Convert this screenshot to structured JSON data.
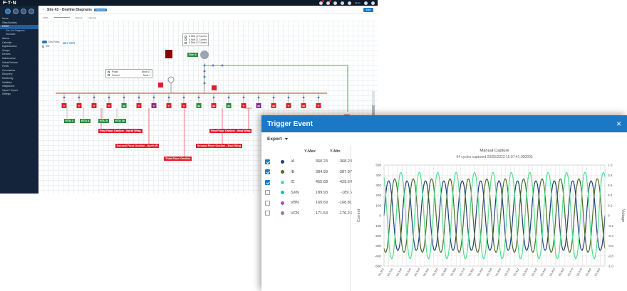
{
  "topbar": {
    "logo": "F∙T∙N",
    "user": "admin",
    "notification_badges": [
      "1",
      "1",
      "2",
      "1"
    ]
  },
  "sidebar": {
    "items": [
      {
        "label": "Home"
      },
      {
        "label": "Sites/Subsites"
      },
      {
        "label": "DTMO",
        "active": true
      },
      {
        "label": "Site List Diagrams",
        "sub": true
      },
      {
        "label": "Standard",
        "sub": true
      },
      {
        "label": "Alarms"
      },
      {
        "label": "Calendar"
      },
      {
        "label": "Digital Access"
      },
      {
        "label": "Groups"
      },
      {
        "label": "Devices"
      },
      {
        "label": "Maintenance"
      },
      {
        "label": "Virtual Devices"
      },
      {
        "label": "Points"
      },
      {
        "label": "Connections"
      },
      {
        "label": "Discovery"
      },
      {
        "label": "Monitoring"
      },
      {
        "label": "Variables"
      },
      {
        "label": "Integrations"
      },
      {
        "label": "Import / Export"
      },
      {
        "label": "Settings"
      }
    ]
  },
  "header": {
    "back": "‹",
    "title": "Site 43 - Oneline Diagrams",
    "badge": "PREVIEW",
    "edit": "Edit"
  },
  "toolbar": {
    "zoom": "100%",
    "mode": "Shared",
    "type": "Lifecycle"
  },
  "canvas": {
    "toggle1": "Only Rows",
    "toggle2": "Site",
    "inline": "SELF TEST",
    "box_top": [
      "A Side | 2 Current",
      "A Side | 1 Current",
      "A Side | 2 Current"
    ],
    "box_left": {
      "r1": "Phase",
      "r1v": "Block 01",
      "r2": "Current",
      "r2v": "Node 1"
    },
    "gen": "Gen 3",
    "rtus": [
      "RTU 1",
      "RTU 3",
      "RTU 5",
      "RTU 10"
    ],
    "floors": [
      "First Floor Oneline - North Wing",
      "Second Floor Oneline - North W",
      "Third Floor Oneline",
      "Second Floor Oneline - East Wing",
      "First Floor Oneline - East Wing"
    ],
    "breakers": [
      {
        "t": "T",
        "c": "red"
      },
      {
        "t": "T",
        "c": "red"
      },
      {
        "t": "T",
        "c": "red"
      },
      {
        "t": "T",
        "c": "red"
      },
      {
        "t": "M",
        "c": "green"
      },
      {
        "t": "T",
        "c": "red"
      },
      {
        "t": "T",
        "c": "purple"
      },
      {
        "t": "T",
        "c": "red"
      },
      {
        "t": "T",
        "c": "red"
      },
      {
        "t": "M",
        "c": "green"
      },
      {
        "t": "M",
        "c": "red"
      },
      {
        "t": "M",
        "c": "green"
      },
      {
        "t": "T",
        "c": "red"
      },
      {
        "t": "M",
        "c": "purple"
      },
      {
        "t": "M",
        "c": "red"
      },
      {
        "t": "T",
        "c": "red"
      },
      {
        "t": "M",
        "c": "red"
      },
      {
        "t": "T",
        "c": "red"
      }
    ],
    "line_labels": [
      "M",
      "M",
      "T",
      "M",
      "M",
      "T"
    ]
  },
  "dialog": {
    "title": "Trigger Event",
    "close": "×",
    "export": "Export",
    "col_max": "Y-Max",
    "col_min": "Y-Min",
    "series": [
      {
        "name": "IA",
        "max": "360.23",
        "min": "-368.23",
        "checked": true,
        "color": "#1e3f78"
      },
      {
        "name": "IB",
        "max": "384.99",
        "min": "-387.97",
        "checked": true,
        "color": "#4b6b2a"
      },
      {
        "name": "IC",
        "max": "455.68",
        "min": "-429.64",
        "checked": true,
        "color": "#4fe08a"
      },
      {
        "name": "SXN",
        "max": "189.93",
        "min": "-189.5",
        "checked": false,
        "color": "#20b8a8"
      },
      {
        "name": "VBN",
        "max": "169.69",
        "min": "-168.81",
        "checked": false,
        "color": "#a050c8"
      },
      {
        "name": "VCN",
        "max": "171.53",
        "min": "-176.26",
        "checked": false,
        "color": "#a070b8"
      }
    ]
  },
  "chart_data": {
    "type": "line",
    "title": "Manual Capture",
    "subtitle": "64 cycles captured 23/05/2023 15:07:41.000003",
    "ylabel": "Current",
    "y2label": "Voltage",
    "ylim": [
      -500,
      500
    ],
    "y2lim": [
      -1,
      1
    ],
    "yticks": [
      "500",
      "400",
      "300",
      "200",
      "100",
      "0",
      "-100",
      "-200",
      "-300",
      "-400",
      "-500"
    ],
    "y2ticks": [
      "1.0",
      "0.8",
      "0.6",
      "0.4",
      "0.2",
      "0",
      "-0.2",
      "-0.4",
      "-0.6",
      "-0.8",
      "-1.0"
    ],
    "xticks": [
      "05.302",
      "05.306",
      "05.310",
      "05.314",
      "05.318",
      "05.322",
      "05.326",
      "05.330",
      "05.334",
      "05.338",
      "05.342",
      "05.346",
      "05.350",
      "05.354",
      "05.358",
      "05.362",
      "05.366",
      "05.370",
      "05.374",
      "05.378",
      "05.382",
      "05.386",
      "05.390",
      "05.394",
      "05.398",
      "05.402",
      "05.406",
      "05.410",
      "05.414",
      "05.418",
      "05.422",
      "05.426",
      "05.430",
      "05.434",
      "05.438",
      "05.442",
      "05.446",
      "05.450",
      "05.454",
      "05.458",
      "05.462",
      "05.466",
      "05.470",
      "05.474",
      "05.478",
      "05.482",
      "05.486",
      "05.490",
      "05.494",
      "05.498"
    ],
    "cycles": 12,
    "series": [
      {
        "name": "IA",
        "amplitude": 355,
        "phase_deg": 0,
        "color": "#1e3f78"
      },
      {
        "name": "IB",
        "amplitude": 375,
        "phase_deg": -120,
        "color": "#4b6b2a"
      },
      {
        "name": "IC",
        "amplitude": 440,
        "phase_deg": 120,
        "color": "#4fe08a"
      }
    ]
  }
}
